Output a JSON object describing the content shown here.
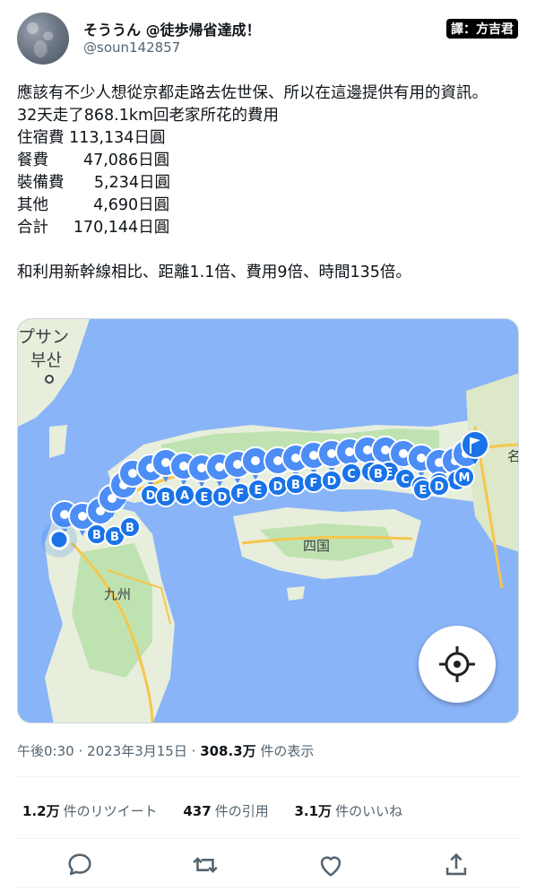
{
  "author": {
    "display_name": "そううん @徒歩帰省達成！",
    "handle": "@soun142857",
    "avatar_icon": "avatar-photo"
  },
  "translator_badge": "譯：方吉君",
  "text": {
    "line1": "應該有不少人想從京都走路去佐世保、所以在這邊提供有用的資訊。",
    "line2": "32天走了868.1km回老家所花的費用",
    "costs": [
      {
        "label": "住宿費",
        "value": "113,134日圓"
      },
      {
        "label": "餐費",
        "value": "47,086日圓"
      },
      {
        "label": "裝備費",
        "value": "5,234日圓"
      },
      {
        "label": "其他",
        "value": "4,690日圓"
      },
      {
        "label": "合計",
        "value": "170,144日圓"
      }
    ],
    "line3": "和利用新幹線相比、距離1.1倍、費用9倍、時間135倍。"
  },
  "map": {
    "labels": {
      "busan_kana": "プサン",
      "busan_hangul": "부산",
      "kyushu": "九州",
      "shikoku": "四国",
      "edge_char": "名"
    },
    "pin_letters": [
      "B",
      "B",
      "B",
      "D",
      "B",
      "A",
      "E",
      "D",
      "F",
      "E",
      "D",
      "B",
      "F",
      "D",
      "C",
      "F",
      "E",
      "C",
      "B",
      "F",
      "C",
      "B",
      "E",
      "D",
      "M"
    ],
    "locate_icon": "crosshair-icon",
    "flag_icon": "flag-icon",
    "colors": {
      "sea": "#8ab4f8",
      "land": "#e8eedc",
      "green": "#bfe3b0",
      "pin": "#1a73e8",
      "pin_ring": "#4c8df6",
      "road": "#f6c64a"
    }
  },
  "meta": {
    "time": "午後0:30",
    "date": "2023年3月15日",
    "sep": "·",
    "views": "308.3万",
    "views_label": "件の表示"
  },
  "stats": {
    "retweets_count": "1.2万",
    "retweets_label": "件のリツイート",
    "quotes_count": "437",
    "quotes_label": "件の引用",
    "likes_count": "3.1万",
    "likes_label": "件のいいね"
  },
  "actions": {
    "reply_icon": "reply-icon",
    "retweet_icon": "retweet-icon",
    "like_icon": "like-icon",
    "share_icon": "share-icon"
  }
}
